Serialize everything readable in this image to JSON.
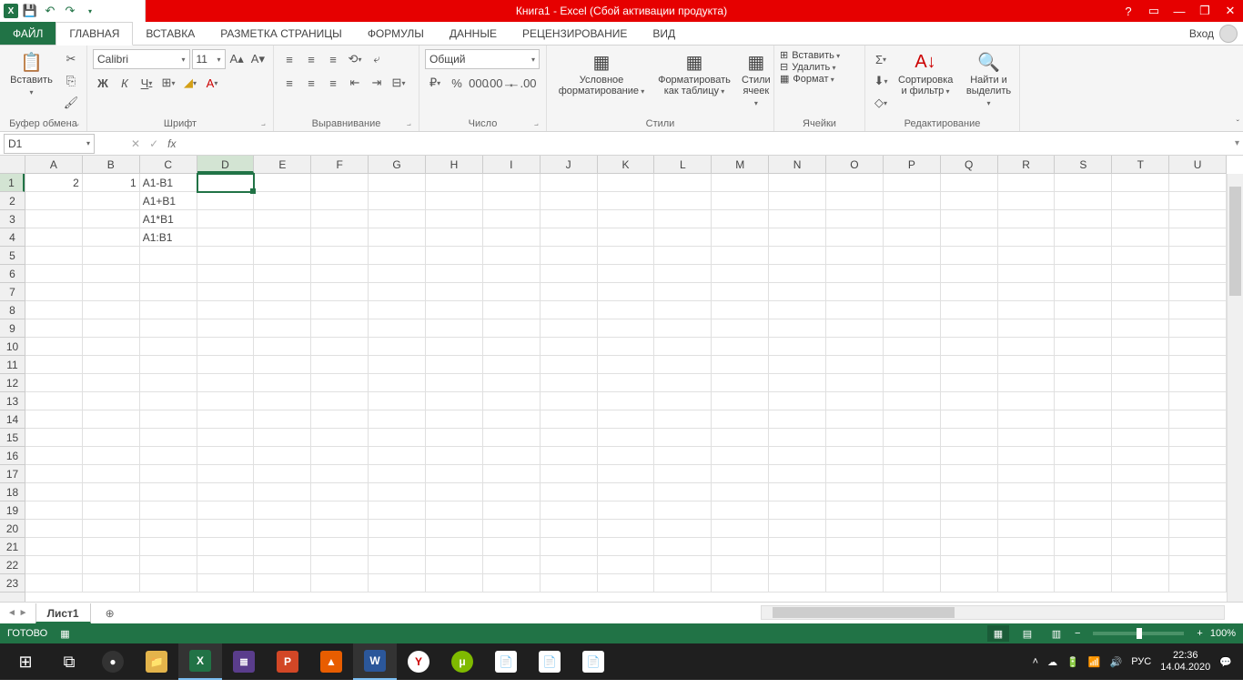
{
  "title": "Книга1 -  Excel (Сбой активации продукта)",
  "tabs": {
    "file": "ФАЙЛ",
    "items": [
      "ГЛАВНАЯ",
      "ВСТАВКА",
      "РАЗМЕТКА СТРАНИЦЫ",
      "ФОРМУЛЫ",
      "ДАННЫЕ",
      "РЕЦЕНЗИРОВАНИЕ",
      "ВИД"
    ],
    "active": 0,
    "login": "Вход"
  },
  "ribbon": {
    "clipboard": {
      "paste": "Вставить",
      "label": "Буфер обмена"
    },
    "font": {
      "name": "Calibri",
      "size": "11",
      "label": "Шрифт",
      "bold": "Ж",
      "italic": "К",
      "underline": "Ч"
    },
    "align": {
      "label": "Выравнивание"
    },
    "number": {
      "format": "Общий",
      "label": "Число"
    },
    "styles": {
      "cond": "Условное форматирование",
      "table": "Форматировать как таблицу",
      "cell": "Стили ячеек",
      "label": "Стили"
    },
    "cells": {
      "insert": "Вставить",
      "delete": "Удалить",
      "format": "Формат",
      "label": "Ячейки"
    },
    "editing": {
      "sort": "Сортировка и фильтр",
      "find": "Найти и выделить",
      "label": "Редактирование"
    }
  },
  "namebox": "D1",
  "formula": "",
  "columns": [
    "A",
    "B",
    "C",
    "D",
    "E",
    "F",
    "G",
    "H",
    "I",
    "J",
    "K",
    "L",
    "M",
    "N",
    "O",
    "P",
    "Q",
    "R",
    "S",
    "T",
    "U"
  ],
  "rows": 23,
  "selected": {
    "col": 3,
    "row": 0
  },
  "cells": {
    "0": {
      "0": "2",
      "1": "1",
      "2": "A1-B1"
    },
    "1": {
      "2": "A1+B1"
    },
    "2": {
      "2": "A1*B1"
    },
    "3": {
      "2": "A1:B1"
    }
  },
  "numericCols": [
    0,
    1
  ],
  "sheet": {
    "name": "Лист1"
  },
  "status": {
    "ready": "ГОТОВО",
    "zoom": "100%"
  },
  "tray": {
    "lang": "РУС",
    "time": "22:36",
    "date": "14.04.2020"
  }
}
